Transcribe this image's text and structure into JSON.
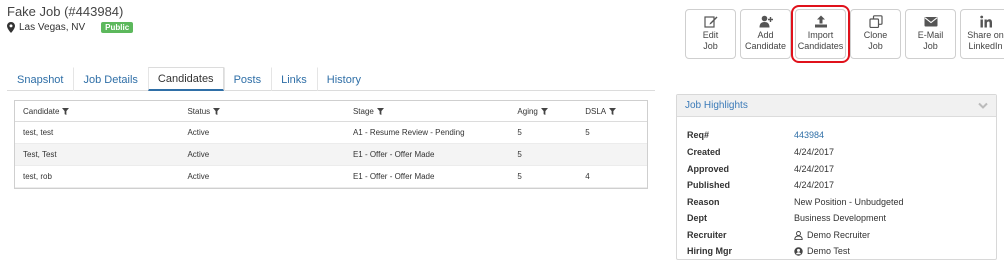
{
  "job": {
    "title": "Fake Job (#443984)",
    "location": "Las Vegas, NV",
    "visibility": "Public",
    "location_icon": "map-pin-icon"
  },
  "actions": [
    {
      "id": "edit-job",
      "label": "Edit\nJob",
      "icon": "edit-icon"
    },
    {
      "id": "add-candidate",
      "label": "Add\nCandidate",
      "icon": "add-user-icon"
    },
    {
      "id": "import-candidates",
      "label": "Import\nCandidates",
      "icon": "upload-icon",
      "highlighted": true
    },
    {
      "id": "clone-job",
      "label": "Clone\nJob",
      "icon": "clone-icon"
    },
    {
      "id": "email-job",
      "label": "E-Mail\nJob",
      "icon": "envelope-icon"
    },
    {
      "id": "share-linkedin",
      "label": "Share on\nLinkedIn",
      "icon": "linkedin-icon"
    }
  ],
  "tabs": [
    {
      "label": "Snapshot",
      "active": false
    },
    {
      "label": "Job Details",
      "active": false
    },
    {
      "label": "Candidates",
      "active": true
    },
    {
      "label": "Posts",
      "active": false
    },
    {
      "label": "Links",
      "active": false
    },
    {
      "label": "History",
      "active": false
    }
  ],
  "candidates": {
    "columns": [
      "Candidate",
      "Status",
      "Stage",
      "Aging",
      "DSLA"
    ],
    "rows": [
      [
        "test, test",
        "Active",
        "A1 - Resume Review - Pending",
        "5",
        "5"
      ],
      [
        "Test, Test",
        "Active",
        "E1 - Offer - Offer Made",
        "5",
        ""
      ],
      [
        "test, rob",
        "Active",
        "E1 - Offer - Offer Made",
        "5",
        "4"
      ]
    ]
  },
  "highlights": {
    "title": "Job Highlights",
    "rows": [
      {
        "label": "Req#",
        "value": "443984",
        "link": true
      },
      {
        "label": "Created",
        "value": "4/24/2017"
      },
      {
        "label": "Approved",
        "value": "4/24/2017"
      },
      {
        "label": "Published",
        "value": "4/24/2017"
      },
      {
        "label": "Reason",
        "value": "New Position - Unbudgeted"
      },
      {
        "label": "Dept",
        "value": "Business Development"
      },
      {
        "label": "Recruiter",
        "value": "Demo Recruiter",
        "icon": "user-outline-icon"
      },
      {
        "label": "Hiring Mgr",
        "value": "Demo Test",
        "icon": "user-circle-icon"
      }
    ]
  },
  "colors": {
    "accent": "#2f6fa7",
    "badge": "#5cb85c",
    "highlight_outline": "#e0111b"
  }
}
